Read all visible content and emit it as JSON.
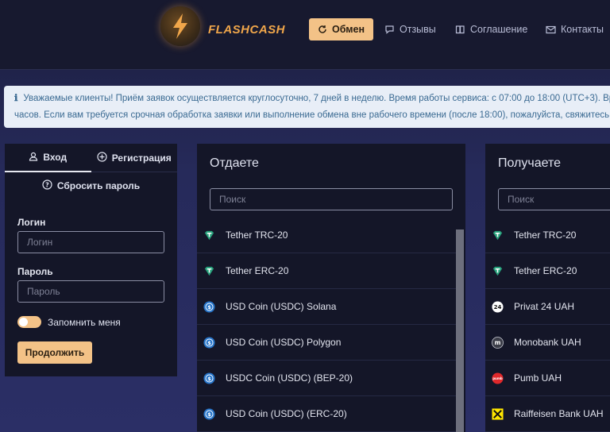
{
  "header": {
    "brand": "FLASHCASH",
    "nav": [
      {
        "label": "Обмен",
        "icon": "refresh-icon",
        "active": true
      },
      {
        "label": "Отзывы",
        "icon": "chat-icon"
      },
      {
        "label": "Соглашение",
        "icon": "book-icon"
      },
      {
        "label": "Контакты",
        "icon": "mail-icon"
      }
    ]
  },
  "notice": {
    "line1": "Уважаемые клиенты! Приём заявок осуществляется круглосуточно, 7 дней в неделю. Время работы сервиса: с 07:00 до 18:00 (UTC+3). Вре",
    "line2": "часов. Если вам требуется срочная обработка заявки или выполнение обмена вне рабочего времени (после 18:00), пожалуйста, свяжитесь с"
  },
  "auth": {
    "tab_login": "Вход",
    "tab_register": "Регистрация",
    "reset_password": "Сбросить пароль",
    "login_label": "Логин",
    "login_placeholder": "Логин",
    "password_label": "Пароль",
    "password_placeholder": "Пароль",
    "remember_label": "Запомнить меня",
    "remember_on": true,
    "continue_label": "Продолжить"
  },
  "give": {
    "title": "Отдаете",
    "search_placeholder": "Поиск",
    "items": [
      {
        "label": "Tether TRC-20",
        "icon": "tether-icon"
      },
      {
        "label": "Tether ERC-20",
        "icon": "tether-icon"
      },
      {
        "label": "USD Coin (USDC) Solana",
        "icon": "usdc-icon"
      },
      {
        "label": "USD Coin (USDC) Polygon",
        "icon": "usdc-icon"
      },
      {
        "label": "USDC Coin (USDC) (BEP-20)",
        "icon": "usdc-icon"
      },
      {
        "label": "USD Coin (USDC) (ERC-20)",
        "icon": "usdc-icon"
      }
    ]
  },
  "get": {
    "title": "Получаете",
    "search_placeholder": "Поиск",
    "items": [
      {
        "label": "Tether TRC-20",
        "icon": "tether-icon"
      },
      {
        "label": "Tether ERC-20",
        "icon": "tether-icon"
      },
      {
        "label": "Privat 24 UAH",
        "icon": "privat24-icon",
        "icon_text": "24"
      },
      {
        "label": "Monobank UAH",
        "icon": "monobank-icon",
        "icon_text": "m"
      },
      {
        "label": "Pumb UAH",
        "icon": "pumb-icon",
        "icon_text": "pumb"
      },
      {
        "label": "Raiffeisen Bank UAH",
        "icon": "raiffeisen-icon"
      }
    ]
  },
  "colors": {
    "accent": "#f3c287",
    "panel": "#141628",
    "tether": "#26a17b",
    "usdc": "#2775ca"
  }
}
